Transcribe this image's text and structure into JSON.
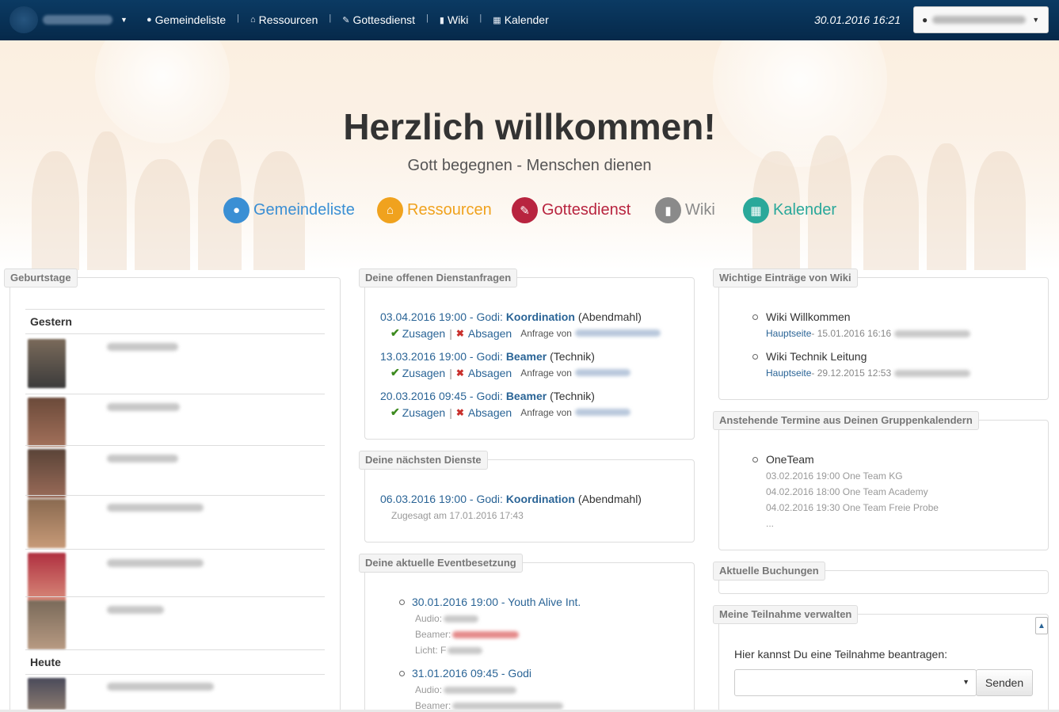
{
  "navbar": {
    "items": [
      {
        "icon": "user-icon",
        "glyph": "●",
        "label": "Gemeindeliste"
      },
      {
        "icon": "home-icon",
        "glyph": "⌂",
        "label": "Ressourcen"
      },
      {
        "icon": "edit-icon",
        "glyph": "✎",
        "label": "Gottesdienst"
      },
      {
        "icon": "book-icon",
        "glyph": "▮",
        "label": "Wiki"
      },
      {
        "icon": "calendar-icon",
        "glyph": "▦",
        "label": "Kalender"
      }
    ],
    "datetime": "30.01.2016 16:21"
  },
  "hero": {
    "title": "Herzlich willkommen!",
    "subtitle": "Gott begegnen - Menschen dienen",
    "links": [
      {
        "label": "Gemeindeliste",
        "icon": "user-icon",
        "glyph": "●",
        "color": "#3a8fd4"
      },
      {
        "label": "Ressourcen",
        "icon": "home-icon",
        "glyph": "⌂",
        "color": "#f0a21e"
      },
      {
        "label": "Gottesdienst",
        "icon": "edit-icon",
        "glyph": "✎",
        "color": "#b8243f"
      },
      {
        "label": "Wiki",
        "icon": "book-icon",
        "glyph": "▮",
        "color": "#8a8a8a"
      },
      {
        "label": "Kalender",
        "icon": "calendar-icon",
        "glyph": "▦",
        "color": "#2aa89a"
      }
    ]
  },
  "birthdays": {
    "title": "Geburtstage",
    "yesterday": "Gestern",
    "today": "Heute"
  },
  "requests": {
    "title": "Deine offenen Dienstanfragen",
    "items": [
      {
        "date": "03.04.2016 19:00",
        "godi": "Godi",
        "role": "Koordination",
        "area": "(Abendmahl)"
      },
      {
        "date": "13.03.2016 19:00",
        "godi": "Godi",
        "role": "Beamer",
        "area": "(Technik)"
      },
      {
        "date": "20.03.2016 09:45",
        "godi": "Godi",
        "role": "Beamer",
        "area": "(Technik)"
      }
    ],
    "accept": "Zusagen",
    "decline": "Absagen",
    "from": "Anfrage von"
  },
  "next_services": {
    "title": "Deine nächsten Dienste",
    "date": "06.03.2016 19:00",
    "godi": "Godi",
    "role": "Koordination",
    "area": "(Abendmahl)",
    "confirmed": "Zugesagt am 17.01.2016 17:43"
  },
  "events": {
    "title": "Deine aktuelle Eventbesetzung",
    "items": [
      {
        "label": "30.01.2016 19:00 - Youth Alive Int.",
        "roles": [
          "Audio:",
          "Beamer:",
          "Licht: F"
        ]
      },
      {
        "label": "31.01.2016 09:45 - Godi",
        "roles": [
          "Audio:",
          "Beamer:"
        ]
      }
    ]
  },
  "wiki": {
    "title": "Wichtige Einträge von Wiki",
    "items": [
      {
        "title": "Wiki Willkommen",
        "page": "Hauptseite",
        "meta": " - 15.01.2016 16:16"
      },
      {
        "title": "Wiki Technik Leitung",
        "page": "Hauptseite",
        "meta": " - 29.12.2015 12:53"
      }
    ]
  },
  "calendar": {
    "title": "Anstehende Termine aus Deinen Gruppenkalendern",
    "group": "OneTeam",
    "entries": [
      "03.02.2016 19:00 One Team KG",
      "04.02.2016 18:00 One Team Academy",
      "04.02.2016 19:30 One Team Freie Probe",
      "..."
    ]
  },
  "bookings": {
    "title": "Aktuelle Buchungen"
  },
  "participation": {
    "title": "Meine Teilnahme verwalten",
    "prompt": "Hier kannst Du eine Teilnahme beantragen:",
    "send": "Senden",
    "select_value": ""
  }
}
